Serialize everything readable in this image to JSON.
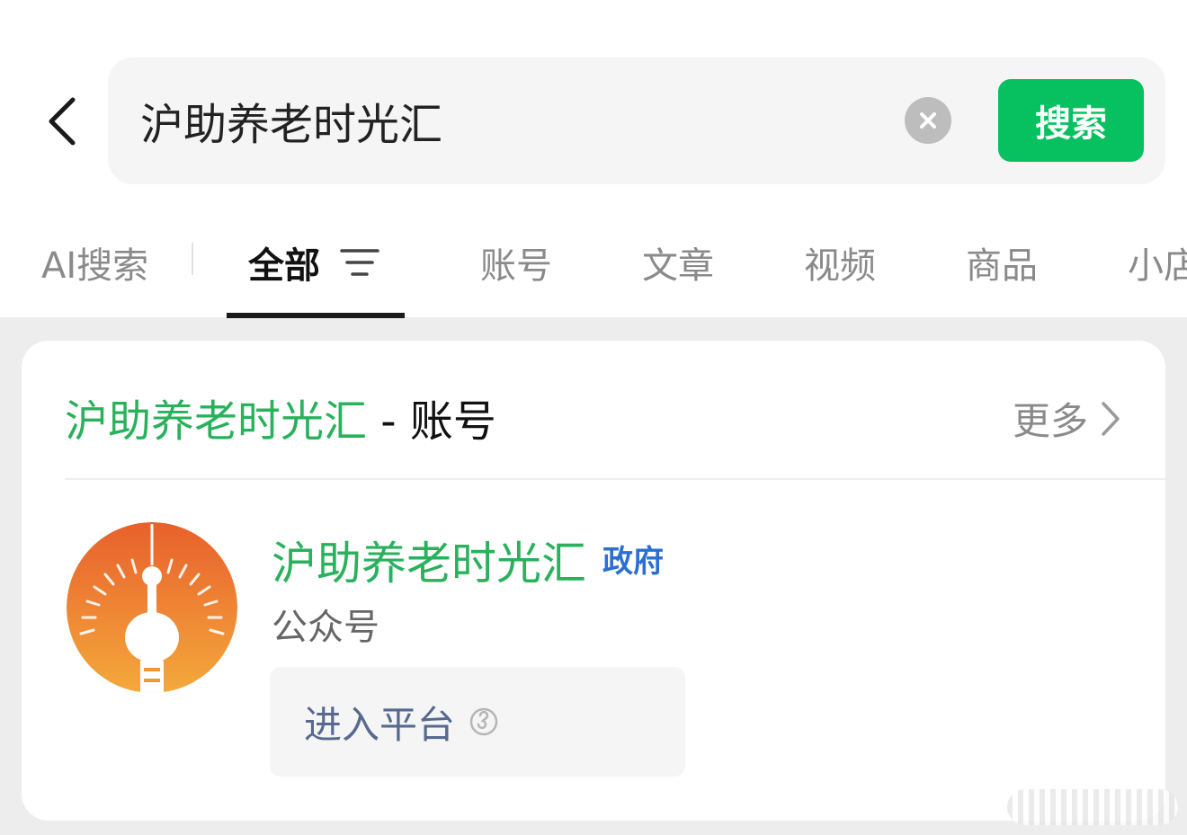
{
  "search": {
    "query": "沪助养老时光汇",
    "button_label": "搜索"
  },
  "tabs": [
    {
      "label": "AI搜索",
      "active": false
    },
    {
      "label": "全部",
      "active": true
    },
    {
      "label": "账号",
      "active": false
    },
    {
      "label": "文章",
      "active": false
    },
    {
      "label": "视频",
      "active": false
    },
    {
      "label": "商品",
      "active": false
    },
    {
      "label": "小店",
      "active": false
    }
  ],
  "result": {
    "keyword": "沪助养老时光汇",
    "separator": " - ",
    "section": "账号",
    "more_label": "更多",
    "account": {
      "name": "沪助养老时光汇",
      "badge": "政府",
      "type": "公众号",
      "enter_label": "进入平台"
    }
  },
  "colors": {
    "accent_green": "#07c160",
    "keyword_green": "#29b15b",
    "badge_blue": "#2b6fd0",
    "avatar_top": "#e8602c",
    "avatar_bottom": "#f4a93c"
  }
}
